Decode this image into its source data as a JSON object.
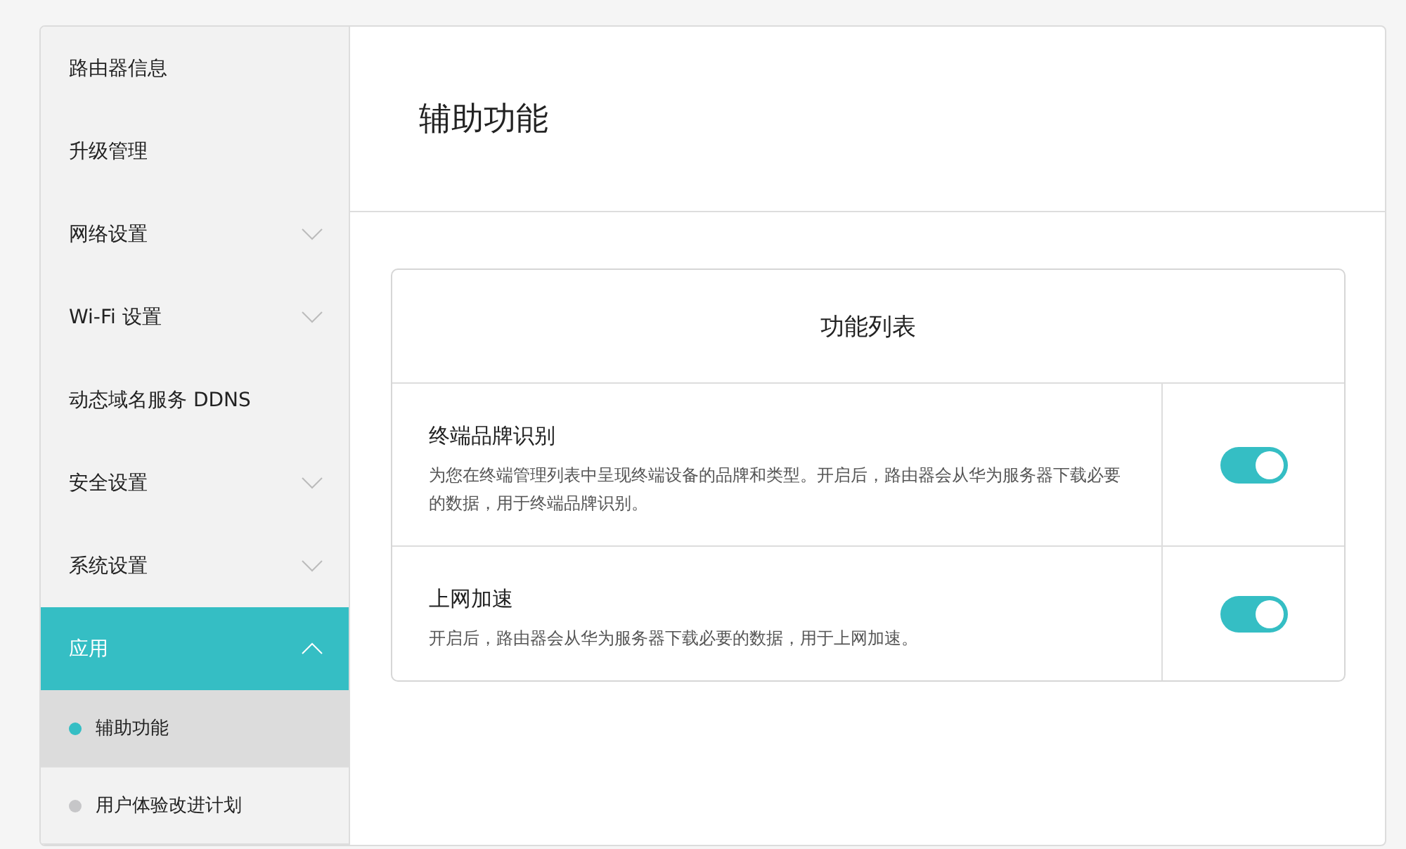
{
  "sidebar": {
    "items": [
      {
        "label": "路由器信息",
        "selected": false
      },
      {
        "label": "升级管理",
        "selected": false
      },
      {
        "label": "网络设置",
        "selected": false,
        "expanded": false
      },
      {
        "label": "Wi-Fi 设置",
        "selected": false,
        "expanded": false
      },
      {
        "label": "动态域名服务 DDNS",
        "selected": false
      },
      {
        "label": "安全设置",
        "selected": false,
        "expanded": false
      },
      {
        "label": "系统设置",
        "selected": false,
        "expanded": false
      },
      {
        "label": "应用",
        "selected": true,
        "expanded": true,
        "children": [
          {
            "label": "辅助功能",
            "selected": true
          },
          {
            "label": "用户体验改进计划",
            "selected": false
          }
        ]
      }
    ]
  },
  "page": {
    "title": "辅助功能"
  },
  "feature_list": {
    "title": "功能列表",
    "rows": [
      {
        "name": "终端品牌识别",
        "description": "为您在终端管理列表中呈现终端设备的品牌和类型。开启后，路由器会从华为服务器下载必要的数据，用于终端品牌识别。",
        "on": true
      },
      {
        "name": "上网加速",
        "description": "开启后，路由器会从华为服务器下载必要的数据，用于上网加速。",
        "on": true
      }
    ]
  }
}
